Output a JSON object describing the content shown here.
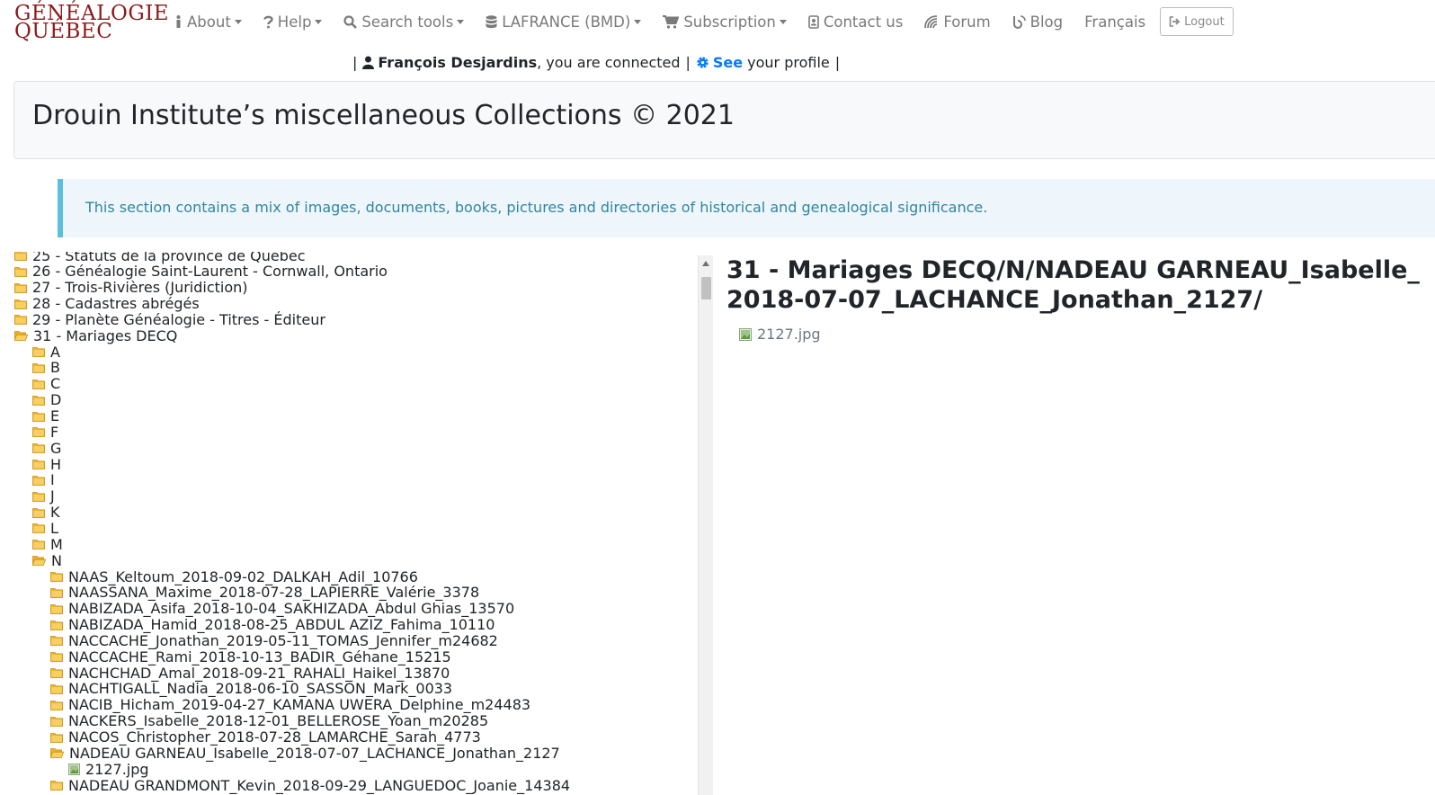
{
  "logo": {
    "line1": "GÉNÉALOGIE",
    "line2": "QUÉBEC"
  },
  "nav": {
    "items": [
      {
        "label": "About",
        "icon": "info-icon",
        "dropdown": true
      },
      {
        "label": "Help",
        "icon": "question-icon",
        "dropdown": true
      },
      {
        "label": "Search tools",
        "icon": "search-icon",
        "dropdown": true
      },
      {
        "label": "LAFRANCE (BMD)",
        "icon": "database-icon",
        "dropdown": true
      },
      {
        "label": "Subscription",
        "icon": "cart-icon",
        "dropdown": true
      },
      {
        "label": "Contact us",
        "icon": "contact-card-icon",
        "dropdown": false
      },
      {
        "label": "Forum",
        "icon": "forum-icon",
        "dropdown": false
      },
      {
        "label": "Blog",
        "icon": "blog-icon",
        "dropdown": false
      },
      {
        "label": "Français",
        "icon": "",
        "dropdown": false
      }
    ],
    "logout_label": "Logout"
  },
  "user": {
    "sep": "|",
    "name": "François Desjardins",
    "connected_text": ", you are connected",
    "see_label": "See",
    "profile_text": "your profile"
  },
  "page": {
    "title": "Drouin Institute’s miscellaneous Collections © 2021",
    "info": "This section contains a mix of images, documents, books, pictures and directories of historical and genealogical significance."
  },
  "tree": {
    "rows": [
      {
        "label": "25 - Statuts de la province de Québec",
        "level": 0,
        "type": "folder"
      },
      {
        "label": "26 - Généalogie Saint-Laurent - Cornwall, Ontario",
        "level": 0,
        "type": "folder"
      },
      {
        "label": "27 - Trois-Rivières (Juridiction)",
        "level": 0,
        "type": "folder"
      },
      {
        "label": "28 - Cadastres abrégés",
        "level": 0,
        "type": "folder"
      },
      {
        "label": "29 - Planète Généalogie - Titres - Éditeur",
        "level": 0,
        "type": "folder"
      },
      {
        "label": "31 - Mariages DECQ",
        "level": 0,
        "type": "folder-open"
      },
      {
        "label": "A",
        "level": 1,
        "type": "folder"
      },
      {
        "label": "B",
        "level": 1,
        "type": "folder"
      },
      {
        "label": "C",
        "level": 1,
        "type": "folder"
      },
      {
        "label": "D",
        "level": 1,
        "type": "folder"
      },
      {
        "label": "E",
        "level": 1,
        "type": "folder"
      },
      {
        "label": "F",
        "level": 1,
        "type": "folder"
      },
      {
        "label": "G",
        "level": 1,
        "type": "folder"
      },
      {
        "label": "H",
        "level": 1,
        "type": "folder"
      },
      {
        "label": "I",
        "level": 1,
        "type": "folder"
      },
      {
        "label": "J",
        "level": 1,
        "type": "folder"
      },
      {
        "label": "K",
        "level": 1,
        "type": "folder"
      },
      {
        "label": "L",
        "level": 1,
        "type": "folder"
      },
      {
        "label": "M",
        "level": 1,
        "type": "folder"
      },
      {
        "label": "N",
        "level": 1,
        "type": "folder-open"
      },
      {
        "label": "NAAS_Keltoum_2018-09-02_DALKAH_Adil_10766",
        "level": 2,
        "type": "folder"
      },
      {
        "label": "NAASSANA_Maxime_2018-07-28_LAPIERRE_Valérie_3378",
        "level": 2,
        "type": "folder"
      },
      {
        "label": "NABIZADA_Asifa_2018-10-04_SAKHIZADA_Abdul Ghias_13570",
        "level": 2,
        "type": "folder"
      },
      {
        "label": "NABIZADA_Hamid_2018-08-25_ABDUL AZIZ_Fahima_10110",
        "level": 2,
        "type": "folder"
      },
      {
        "label": "NACCACHE_Jonathan_2019-05-11_TOMAS_Jennifer_m24682",
        "level": 2,
        "type": "folder"
      },
      {
        "label": "NACCACHE_Rami_2018-10-13_BADIR_Géhane_15215",
        "level": 2,
        "type": "folder"
      },
      {
        "label": "NACHCHAD_Amal_2018-09-21_RAHALI_Haikel_13870",
        "level": 2,
        "type": "folder"
      },
      {
        "label": "NACHTIGALL_Nadia_2018-06-10_SASSON_Mark_0033",
        "level": 2,
        "type": "folder"
      },
      {
        "label": "NACIB_Hicham_2019-04-27_KAMANA UWERA_Delphine_m24483",
        "level": 2,
        "type": "folder"
      },
      {
        "label": "NACKERS_Isabelle_2018-12-01_BELLEROSE_Yoan_m20285",
        "level": 2,
        "type": "folder"
      },
      {
        "label": "NACOS_Christopher_2018-07-28_LAMARCHE_Sarah_4773",
        "level": 2,
        "type": "folder"
      },
      {
        "label": "NADEAU GARNEAU_Isabelle_2018-07-07_LACHANCE_Jonathan_2127",
        "level": 2,
        "type": "folder-open"
      },
      {
        "label": "2127.jpg",
        "level": 3,
        "type": "image"
      },
      {
        "label": "NADEAU GRANDMONT_Kevin_2018-09-29_LANGUEDOC_Joanie_14384",
        "level": 2,
        "type": "folder"
      }
    ]
  },
  "detail": {
    "path": "31 - Mariages DECQ/N/NADEAU GARNEAU_Isabelle_2018-07-07_LACHANCE_Jonathan_2127/",
    "file": "2127.jpg"
  },
  "colors": {
    "brand": "#8b1a1a",
    "link": "#007bff",
    "folder": "#f0b429",
    "info_text": "#31869f",
    "info_border": "#5bc0de"
  }
}
